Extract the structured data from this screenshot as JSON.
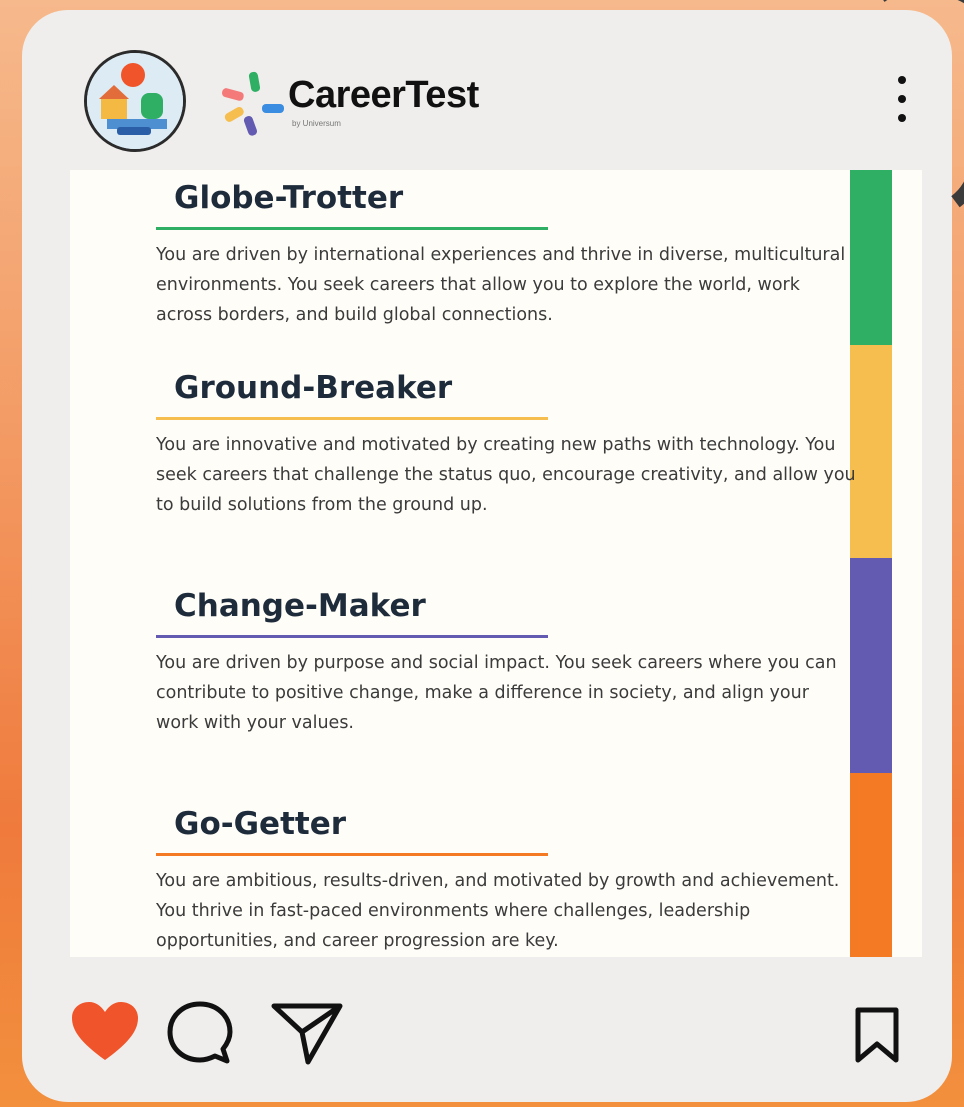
{
  "header": {
    "brand_name": "CareerTest",
    "brand_tagline": "by Universum",
    "more_icon": "more-vertical-icon",
    "avatar_icon": "profile-avatar"
  },
  "sections": [
    {
      "title": "Globe-Trotter",
      "body": "You are driven by international experiences and thrive in diverse, multicultural environments. You seek careers that allow you to explore the world, work across borders, and build global connections.",
      "color": "#2eaf63"
    },
    {
      "title": "Ground-Breaker",
      "body": "You are innovative and motivated by creating new paths with technology. You seek careers that challenge the status quo, encourage creativity, and allow you to build solutions from the ground up.",
      "color": "#f6bd4f"
    },
    {
      "title": "Change-Maker",
      "body": "You are driven by purpose and social impact. You seek careers where you can contribute to positive change, make a difference in society, and align your work with your values.",
      "color": "#635bb1"
    },
    {
      "title": "Go-Getter",
      "body": "You are ambitious, results-driven, and motivated by growth and achievement. You thrive in fast-paced environments where challenges, leadership opportunities, and career progression are key.",
      "color": "#f47a23"
    }
  ],
  "actions": {
    "like_icon": "heart-icon",
    "like_color": "#f0542a",
    "comment_icon": "comment-icon",
    "share_icon": "send-icon",
    "save_icon": "bookmark-icon"
  }
}
